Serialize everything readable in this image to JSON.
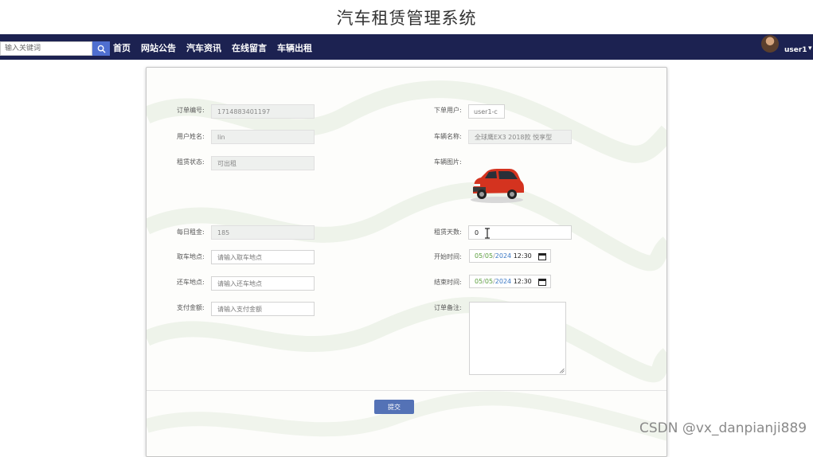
{
  "site": {
    "title": "汽车租赁管理系统"
  },
  "navbar": {
    "search_placeholder": "输入关键词",
    "items": [
      "首页",
      "网站公告",
      "汽车资讯",
      "在线留言",
      "车辆出租"
    ],
    "username": "user1",
    "caret": "▾"
  },
  "form": {
    "order_no": {
      "label": "订单编号:",
      "value": "1714883401197"
    },
    "user_account": {
      "label": "下单用户:",
      "value": "user1-c"
    },
    "user_name": {
      "label": "用户姓名:",
      "value": "lin"
    },
    "car_name": {
      "label": "车辆名称:",
      "value": "全球鹰EX3 2018款 悦享型"
    },
    "rent_status": {
      "label": "租赁状态:",
      "value": "可出租"
    },
    "car_image": {
      "label": "车辆图片:"
    },
    "daily_rent": {
      "label": "每日租金:",
      "value": "185"
    },
    "rent_days": {
      "label": "租赁天数:",
      "value": "0"
    },
    "pickup_place": {
      "label": "取车地点:",
      "placeholder": "请输入取车地点"
    },
    "start_time": {
      "label": "开始时间:",
      "month": "05",
      "day": "05",
      "year": "2024",
      "time": "12:30"
    },
    "return_place": {
      "label": "还车地点:",
      "placeholder": "请输入还车地点"
    },
    "end_time": {
      "label": "结束时间:",
      "month": "05",
      "day": "05",
      "year": "2024",
      "time": "12:30"
    },
    "pay_amount": {
      "label": "支付金额:",
      "placeholder": "请输入支付金额"
    },
    "remark": {
      "label": "订单备注:"
    },
    "submit_label": "提交"
  },
  "watermark": "CSDN @vx_danpianji889",
  "colors": {
    "navbar": "#1c2251",
    "submit": "#5472b6",
    "search_button": "#4f6fd0"
  }
}
